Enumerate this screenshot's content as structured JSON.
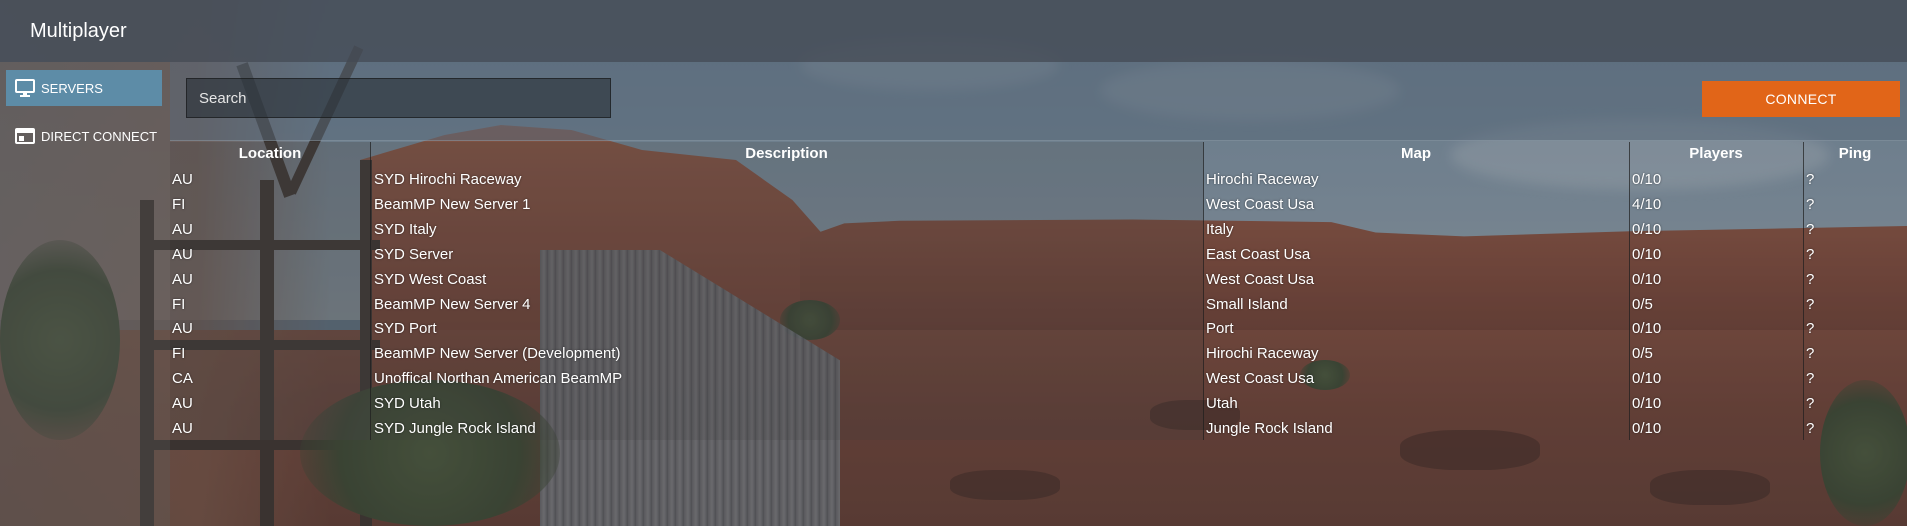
{
  "app": {
    "title": "Multiplayer"
  },
  "sidebar": {
    "items": [
      {
        "label": "SERVERS",
        "icon": "monitor-icon",
        "active": true
      },
      {
        "label": "DIRECT CONNECT",
        "icon": "window-icon",
        "active": false
      }
    ]
  },
  "toolbar": {
    "search_placeholder": "Search",
    "search_value": "",
    "connect_label": "CONNECT",
    "connect_color": "#e16518"
  },
  "table": {
    "columns": [
      "Location",
      "Description",
      "Map",
      "Players",
      "Ping"
    ],
    "rows": [
      {
        "location": "AU",
        "description": "SYD Hirochi Raceway",
        "map": "Hirochi Raceway",
        "players": "0/10",
        "ping": "?"
      },
      {
        "location": "FI",
        "description": "BeamMP New Server 1",
        "map": "West Coast Usa",
        "players": "4/10",
        "ping": "?"
      },
      {
        "location": "AU",
        "description": "SYD Italy",
        "map": "Italy",
        "players": "0/10",
        "ping": "?"
      },
      {
        "location": "AU",
        "description": "SYD Server",
        "map": "East Coast Usa",
        "players": "0/10",
        "ping": "?"
      },
      {
        "location": "AU",
        "description": "SYD West Coast",
        "map": "West Coast Usa",
        "players": "0/10",
        "ping": "?"
      },
      {
        "location": "FI",
        "description": "BeamMP New Server 4",
        "map": "Small Island",
        "players": "0/5",
        "ping": "?"
      },
      {
        "location": "AU",
        "description": "SYD Port",
        "map": "Port",
        "players": "0/10",
        "ping": "?"
      },
      {
        "location": "FI",
        "description": "BeamMP New Server (Development)",
        "map": "Hirochi Raceway",
        "players": "0/5",
        "ping": "?"
      },
      {
        "location": "CA",
        "description": "Unoffical Northan American BeamMP",
        "map": "West Coast Usa",
        "players": "0/10",
        "ping": "?"
      },
      {
        "location": "AU",
        "description": "SYD Utah",
        "map": "Utah",
        "players": "0/10",
        "ping": "?"
      },
      {
        "location": "AU",
        "description": "SYD Jungle Rock Island",
        "map": "Jungle Rock Island",
        "players": "0/10",
        "ping": "?"
      }
    ]
  },
  "colors": {
    "accent_active": "#5d8ca7",
    "topbar": "#464e58"
  }
}
